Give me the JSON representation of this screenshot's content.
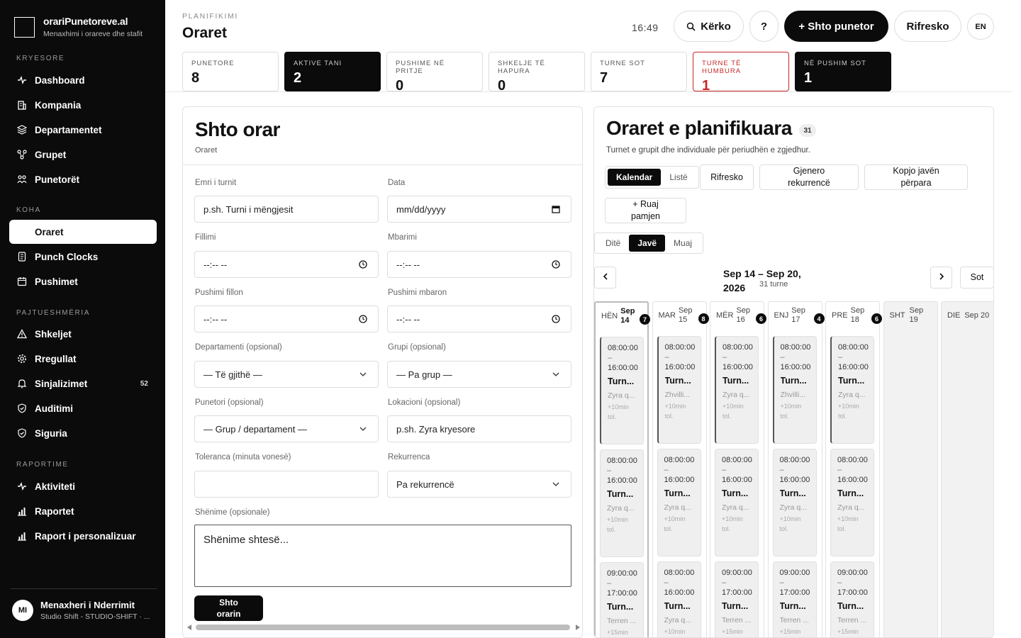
{
  "brand": {
    "title": "orariPunetoreve.al",
    "subtitle": "Menaxhimi i orareve dhe stafit"
  },
  "nav": {
    "sections": [
      "KRYESORE",
      "KOHA",
      "PAJTUESHMËRIA",
      "RAPORTIME"
    ],
    "items": [
      {
        "label": "Dashboard",
        "icon": "activity-icon"
      },
      {
        "label": "Kompania",
        "icon": "building-icon"
      },
      {
        "label": "Departamentet",
        "icon": "layers-icon"
      },
      {
        "label": "Grupet",
        "icon": "network-icon"
      },
      {
        "label": "Punetorët",
        "icon": "users-icon"
      },
      {
        "label": "Oraret",
        "icon": "",
        "active": true
      },
      {
        "label": "Punch Clocks",
        "icon": "tablet-icon"
      },
      {
        "label": "Pushimet",
        "icon": "calendar-icon"
      },
      {
        "label": "Shkeljet",
        "icon": "warning-icon"
      },
      {
        "label": "Rregullat",
        "icon": "gear-icon"
      },
      {
        "label": "Sinjalizimet",
        "icon": "bell-icon",
        "badge": "52"
      },
      {
        "label": "Auditimi",
        "icon": "shield-check-icon"
      },
      {
        "label": "Siguria",
        "icon": "shield-icon"
      },
      {
        "label": "Aktiviteti",
        "icon": "activity-icon"
      },
      {
        "label": "Raportet",
        "icon": "bar-chart-icon"
      },
      {
        "label": "Raport i personalizuar",
        "icon": "bar-chart-icon"
      }
    ]
  },
  "user": {
    "initials": "MI",
    "name": "Menaxheri i Nderrimit",
    "subtitle": "Studio Shift - STUDIO-SHIFT · ..."
  },
  "header": {
    "kicker": "PLANIFIKIMI",
    "title": "Oraret",
    "clock": "16:49",
    "search_label": "Kërko",
    "help_label": "?",
    "add_label": "+ Shto punetor",
    "refresh_label": "Rifresko",
    "lang_label": "EN"
  },
  "stats": [
    {
      "label": "PUNETORE",
      "value": "8"
    },
    {
      "label": "AKTIVE TANI",
      "value": "2"
    },
    {
      "label": "PUSHIME NË PRITJE",
      "value": "0"
    },
    {
      "label": "SHKELJE TË HAPURA",
      "value": "0"
    },
    {
      "label": "TURNE SOT",
      "value": "7"
    },
    {
      "label": "TURNE TË HUMBURA",
      "value": "1"
    },
    {
      "label": "NË PUSHIM SOT",
      "value": "1"
    }
  ],
  "form": {
    "title": "Shto orar",
    "subtitle": "Oraret",
    "labels": {
      "shift_name": "Emri i turnit",
      "date": "Data",
      "start": "Fillimi",
      "end": "Mbarimi",
      "break_start": "Pushimi fillon",
      "break_end": "Pushimi mbaron",
      "department": "Departamenti (opsional)",
      "group": "Grupi (opsional)",
      "employee": "Punetori (opsional)",
      "location": "Lokacioni (opsional)",
      "tolerance": "Toleranca (minuta vonesë)",
      "recurrence": "Rekurrenca",
      "notes": "Shënime (opsionale)"
    },
    "values": {
      "shift_name": "p.sh. Turni i mëngjesit",
      "date": "mm/dd/yyyy",
      "start": "--:-- --",
      "end": "--:-- --",
      "break_start": "--:-- --",
      "break_end": "--:-- --",
      "department": "— Të gjithë —",
      "group": "— Pa grup —",
      "employee": "— Grup / departament —",
      "location": "p.sh. Zyra kryesore",
      "tolerance": "",
      "recurrence": "Pa rekurrencë",
      "notes": "Shënime shtesë..."
    },
    "submit_line1": "Shto",
    "submit_line2": "orarin"
  },
  "schedule": {
    "title": "Oraret e planifikuara",
    "count": "31",
    "subtitle": "Turnet e grupit dhe individuale për periudhën e zgjedhur.",
    "view_calendar": "Kalendar",
    "view_list": "Listë",
    "refresh": "Rifresko",
    "generate_line1": "Gjenero",
    "generate_line2": "rekurrencë",
    "copy_line1": "Kopjo javën",
    "copy_line2": "përpara",
    "save_line1": "+ Ruaj",
    "save_line2": "pamjen",
    "range_day": "Ditë",
    "range_week": "Javë",
    "range_month": "Muaj",
    "range_line1": "Sep 14 – Sep 20,",
    "range_line2": "2026",
    "range_count": "31 turne",
    "today": "Sot",
    "days": [
      {
        "dn": "HËN",
        "d1": "Sep",
        "d2": "14",
        "count": "7",
        "today": true,
        "shifts": [
          {
            "start": "08:00:00",
            "end": "16:00:00",
            "name": "Turn...",
            "loc": "Zyra q...",
            "tol1": "+10min",
            "tol2": "tol."
          },
          {
            "start": "08:00:00",
            "end": "16:00:00",
            "name": "Turn...",
            "loc": "Zyra q...",
            "tol1": "+10min",
            "tol2": "tol."
          },
          {
            "start": "09:00:00",
            "end": "17:00:00",
            "name": "Turn...",
            "loc": "Terren ...",
            "tol1": "+15min",
            "tol2": ""
          }
        ]
      },
      {
        "dn": "MAR",
        "d1": "Sep",
        "d2": "15",
        "count": "8",
        "shifts": [
          {
            "start": "08:00:00",
            "end": "16:00:00",
            "name": "Turn...",
            "loc": "Zhvilli...",
            "tol1": "+10min",
            "tol2": "tol."
          },
          {
            "start": "08:00:00",
            "end": "16:00:00",
            "name": "Turn...",
            "loc": "Zyra q...",
            "tol1": "+10min",
            "tol2": "tol."
          },
          {
            "start": "08:00:00",
            "end": "16:00:00",
            "name": "Turn...",
            "loc": "Zyra q...",
            "tol1": "+10min",
            "tol2": ""
          }
        ]
      },
      {
        "dn": "MËR",
        "d1": "Sep",
        "d2": "16",
        "count": "6",
        "shifts": [
          {
            "start": "08:00:00",
            "end": "16:00:00",
            "name": "Turn...",
            "loc": "Zyra q...",
            "tol1": "+10min",
            "tol2": "tol."
          },
          {
            "start": "08:00:00",
            "end": "16:00:00",
            "name": "Turn...",
            "loc": "Zyra q...",
            "tol1": "+10min",
            "tol2": "tol."
          },
          {
            "start": "09:00:00",
            "end": "17:00:00",
            "name": "Turn...",
            "loc": "Terren ...",
            "tol1": "+15min",
            "tol2": ""
          }
        ]
      },
      {
        "dn": "ENJ",
        "d1": "Sep",
        "d2": "17",
        "count": "4",
        "shifts": [
          {
            "start": "08:00:00",
            "end": "16:00:00",
            "name": "Turn...",
            "loc": "Zhvilli...",
            "tol1": "+10min",
            "tol2": "tol."
          },
          {
            "start": "08:00:00",
            "end": "16:00:00",
            "name": "Turn...",
            "loc": "Zyra q...",
            "tol1": "+10min",
            "tol2": "tol."
          },
          {
            "start": "09:00:00",
            "end": "17:00:00",
            "name": "Turn...",
            "loc": "Terren ...",
            "tol1": "+15min",
            "tol2": ""
          }
        ]
      },
      {
        "dn": "PRE",
        "d1": "Sep",
        "d2": "18",
        "count": "6",
        "shifts": [
          {
            "start": "08:00:00",
            "end": "16:00:00",
            "name": "Turn...",
            "loc": "Zyra q...",
            "tol1": "+10min",
            "tol2": "tol."
          },
          {
            "start": "08:00:00",
            "end": "16:00:00",
            "name": "Turn...",
            "loc": "Zyra q...",
            "tol1": "+10min",
            "tol2": "tol."
          },
          {
            "start": "09:00:00",
            "end": "17:00:00",
            "name": "Turn...",
            "loc": "Terren ...",
            "tol1": "+15min",
            "tol2": ""
          }
        ]
      },
      {
        "dn": "SHT",
        "d1": "Sep",
        "d2": "19",
        "count": "",
        "weekend": true,
        "shifts": []
      },
      {
        "dn": "DIE",
        "d1": "Sep 20",
        "d2": "",
        "count": "",
        "weekend": true,
        "shifts": []
      }
    ]
  }
}
